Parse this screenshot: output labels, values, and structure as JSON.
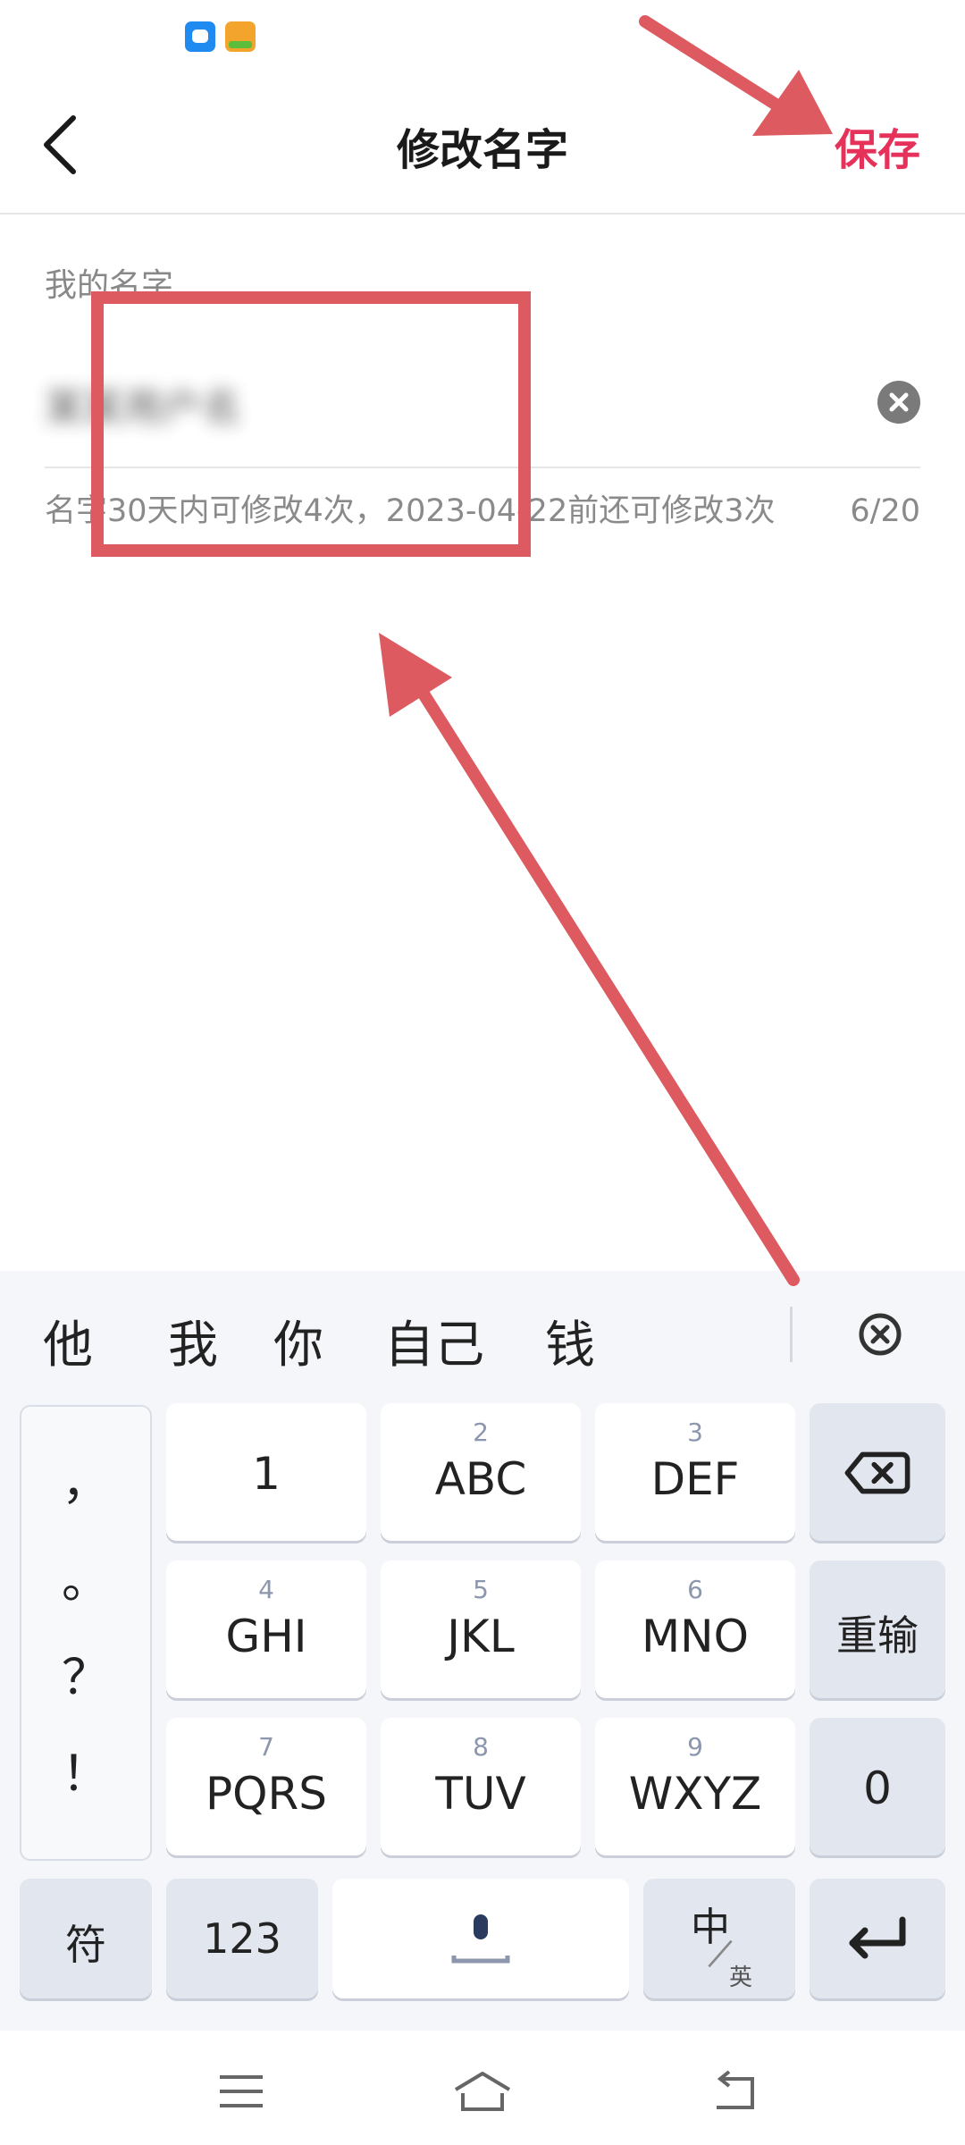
{
  "header": {
    "title": "修改名字",
    "save_label": "保存"
  },
  "form": {
    "label": "我的名字",
    "value": "某某用户名",
    "hint": "名字30天内可修改4次，2023-04-22前还可修改3次",
    "counter": "6/20"
  },
  "keyboard": {
    "candidates": [
      "他",
      "我",
      "你",
      "自己",
      "钱"
    ],
    "punctuation": [
      "，",
      "。",
      "？",
      "！"
    ],
    "keys": {
      "one": "1",
      "abc_digit": "2",
      "abc": "ABC",
      "def_digit": "3",
      "def": "DEF",
      "ghi_digit": "4",
      "ghi": "GHI",
      "jkl_digit": "5",
      "jkl": "JKL",
      "mno_digit": "6",
      "mno": "MNO",
      "reset": "重输",
      "pqrs_digit": "7",
      "pqrs": "PQRS",
      "tuv_digit": "8",
      "tuv": "TUV",
      "wxyz_digit": "9",
      "wxyz": "WXYZ",
      "zero": "0",
      "symbol": "符",
      "num": "123",
      "lang_main": "中",
      "lang_sub": "英"
    }
  },
  "colors": {
    "accent": "#e6325a",
    "annotation": "#dd5a61"
  }
}
